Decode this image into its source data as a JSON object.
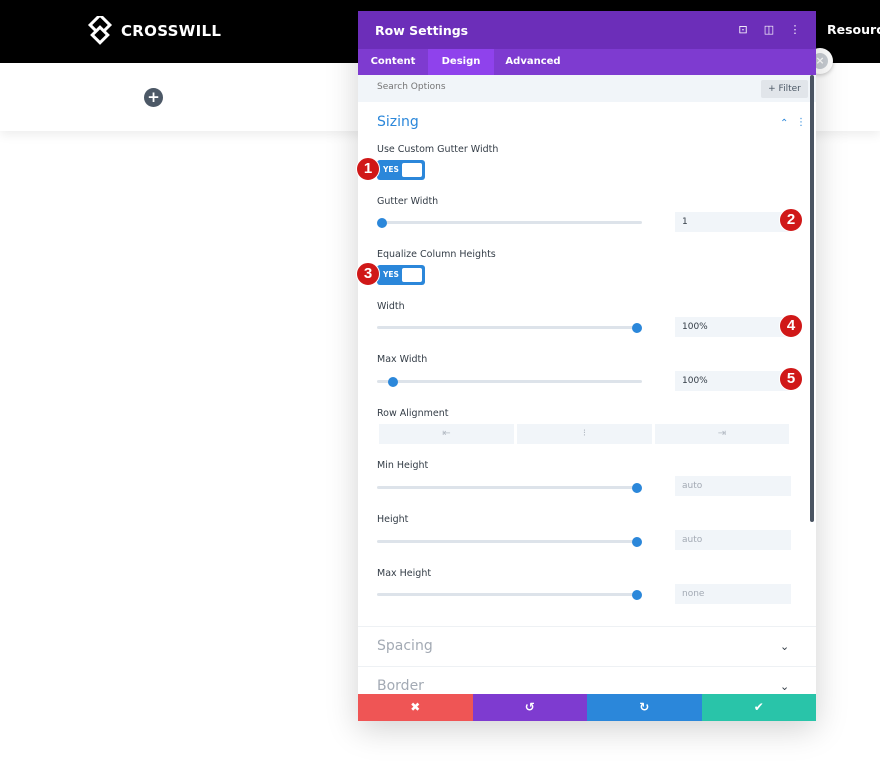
{
  "header": {
    "brand": "CROSSWILL",
    "nav_item": "Resources"
  },
  "modal": {
    "title": "Row Settings",
    "header_icons": [
      "focus-icon",
      "layout-icon",
      "more-icon"
    ],
    "tabs": [
      {
        "label": "Content",
        "active": false
      },
      {
        "label": "Design",
        "active": true
      },
      {
        "label": "Advanced",
        "active": false
      }
    ],
    "search_placeholder": "Search Options",
    "filter_label": "+ Filter",
    "section": {
      "title": "Sizing",
      "fields": {
        "custom_gutter": {
          "label": "Use Custom Gutter Width",
          "toggle": "YES"
        },
        "gutter_width": {
          "label": "Gutter Width",
          "value": "1",
          "slider_fraction": 0.02
        },
        "equalize": {
          "label": "Equalize Column Heights",
          "toggle": "YES"
        },
        "width": {
          "label": "Width",
          "value": "100%",
          "slider_fraction": 0.98
        },
        "max_width": {
          "label": "Max Width",
          "value": "100%",
          "slider_fraction": 0.06
        },
        "row_alignment": {
          "label": "Row Alignment",
          "options": [
            "left-align-icon",
            "center-align-icon",
            "right-align-icon"
          ]
        },
        "min_height": {
          "label": "Min Height",
          "value": "auto",
          "slider_fraction": 0.98
        },
        "height": {
          "label": "Height",
          "value": "auto",
          "slider_fraction": 0.98
        },
        "max_height": {
          "label": "Max Height",
          "value": "none",
          "slider_fraction": 0.98
        }
      }
    },
    "collapsed_sections": [
      "Spacing",
      "Border"
    ],
    "footer": [
      "cancel",
      "undo",
      "redo",
      "save"
    ]
  },
  "badges": [
    "1",
    "2",
    "3",
    "4",
    "5"
  ],
  "colors": {
    "header_purple": "#6c2eb9",
    "tab_purple": "#7e3bd0",
    "accent_blue": "#2b87da",
    "cancel_red": "#ef5555",
    "undo_purple": "#7e3bd0",
    "redo_blue": "#2b87da",
    "save_green": "#29c4a9",
    "badge_red": "#d01818"
  }
}
